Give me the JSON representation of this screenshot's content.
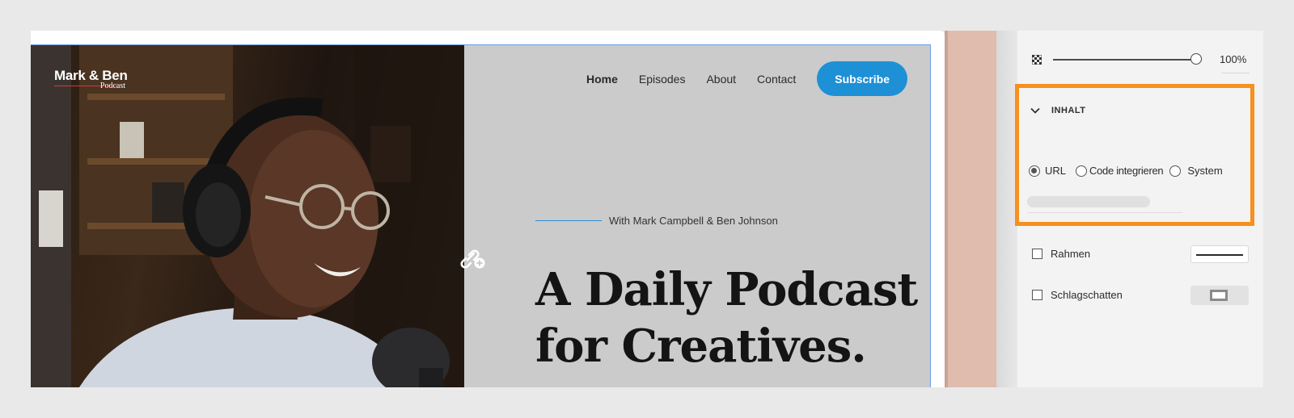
{
  "website": {
    "logo": {
      "name": "Mark & Ben",
      "sub": "Podcast"
    },
    "nav": {
      "items": [
        "Home",
        "Episodes",
        "About",
        "Contact"
      ],
      "active": "Home",
      "subscribe_label": "Subscribe"
    },
    "hero": {
      "tagline": "With Mark Campbell & Ben Johnson",
      "headline_line1": "A Daily Podcast",
      "headline_line2": "for Creatives."
    },
    "colors": {
      "accent": "#1e90d6",
      "panel_bg": "#cbcbcb",
      "selection": "#f7901e"
    }
  },
  "properties": {
    "opacity": {
      "value_label": "100%",
      "value": 1.0
    },
    "content_section": {
      "title": "INHALT",
      "radio_options": [
        "URL",
        "Code integrieren",
        "System"
      ],
      "selected": "URL"
    },
    "border": {
      "label": "Rahmen",
      "checked": false
    },
    "shadow": {
      "label": "Schlagschatten",
      "checked": false
    }
  }
}
